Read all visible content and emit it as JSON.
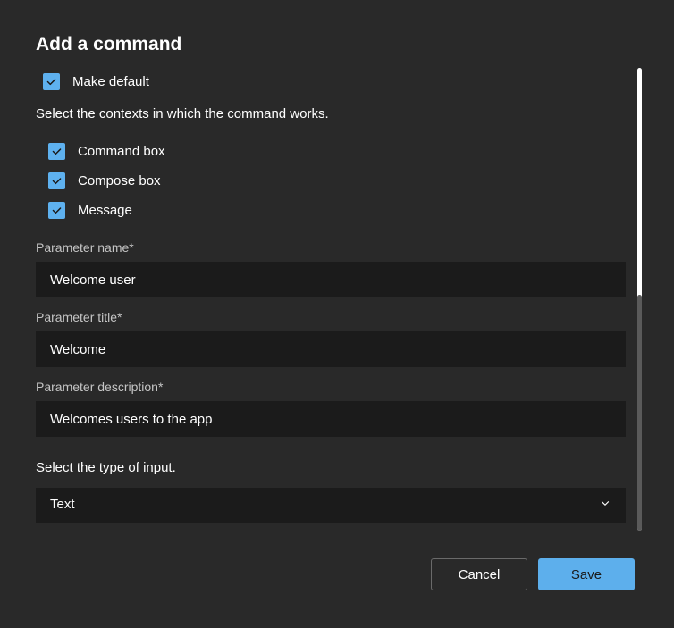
{
  "dialog": {
    "title": "Add a command",
    "makeDefault": {
      "label": "Make default",
      "checked": true
    },
    "contextsLabel": "Select the contexts in which the command works.",
    "contexts": [
      {
        "label": "Command box",
        "checked": true
      },
      {
        "label": "Compose box",
        "checked": true
      },
      {
        "label": "Message",
        "checked": true
      }
    ],
    "fields": {
      "paramName": {
        "label": "Parameter name*",
        "value": "Welcome user"
      },
      "paramTitle": {
        "label": "Parameter title*",
        "value": "Welcome"
      },
      "paramDescription": {
        "label": "Parameter description*",
        "value": "Welcomes users to the app"
      }
    },
    "inputType": {
      "label": "Select the type of input.",
      "selected": "Text"
    },
    "buttons": {
      "cancel": "Cancel",
      "save": "Save"
    }
  }
}
